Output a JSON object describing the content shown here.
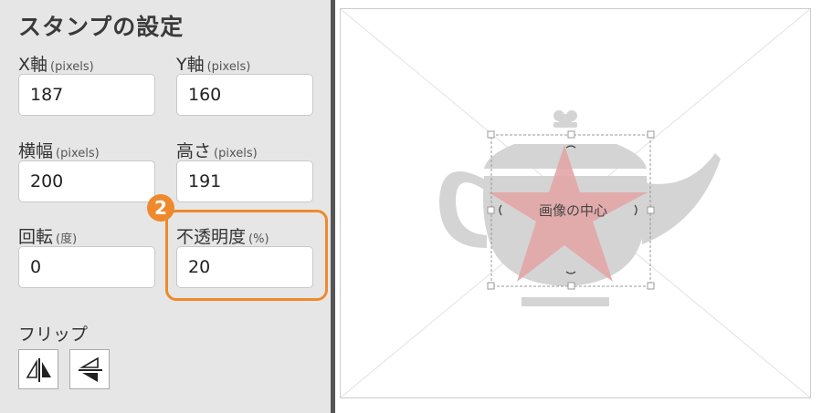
{
  "panel": {
    "title": "スタンプの設定",
    "x": {
      "label": "X軸",
      "unit": "(pixels)",
      "value": "187"
    },
    "y": {
      "label": "Y軸",
      "unit": "(pixels)",
      "value": "160"
    },
    "width": {
      "label": "横幅",
      "unit": "(pixels)",
      "value": "200"
    },
    "height": {
      "label": "高さ",
      "unit": "(pixels)",
      "value": "191"
    },
    "rotation": {
      "label": "回転",
      "unit": "(度)",
      "value": "0"
    },
    "opacity": {
      "label": "不透明度",
      "unit": "(%)",
      "value": "20"
    },
    "flip": {
      "label": "フリップ"
    },
    "badge": "2"
  },
  "canvas": {
    "center_label": "画像の中心"
  },
  "colors": {
    "accent": "#ee8a2d",
    "panel_bg": "#e6e6e6",
    "teapot": "#d4d4d4",
    "star": "#e3a6a6"
  },
  "icons": [
    "flip-horizontal-icon",
    "flip-vertical-icon"
  ]
}
